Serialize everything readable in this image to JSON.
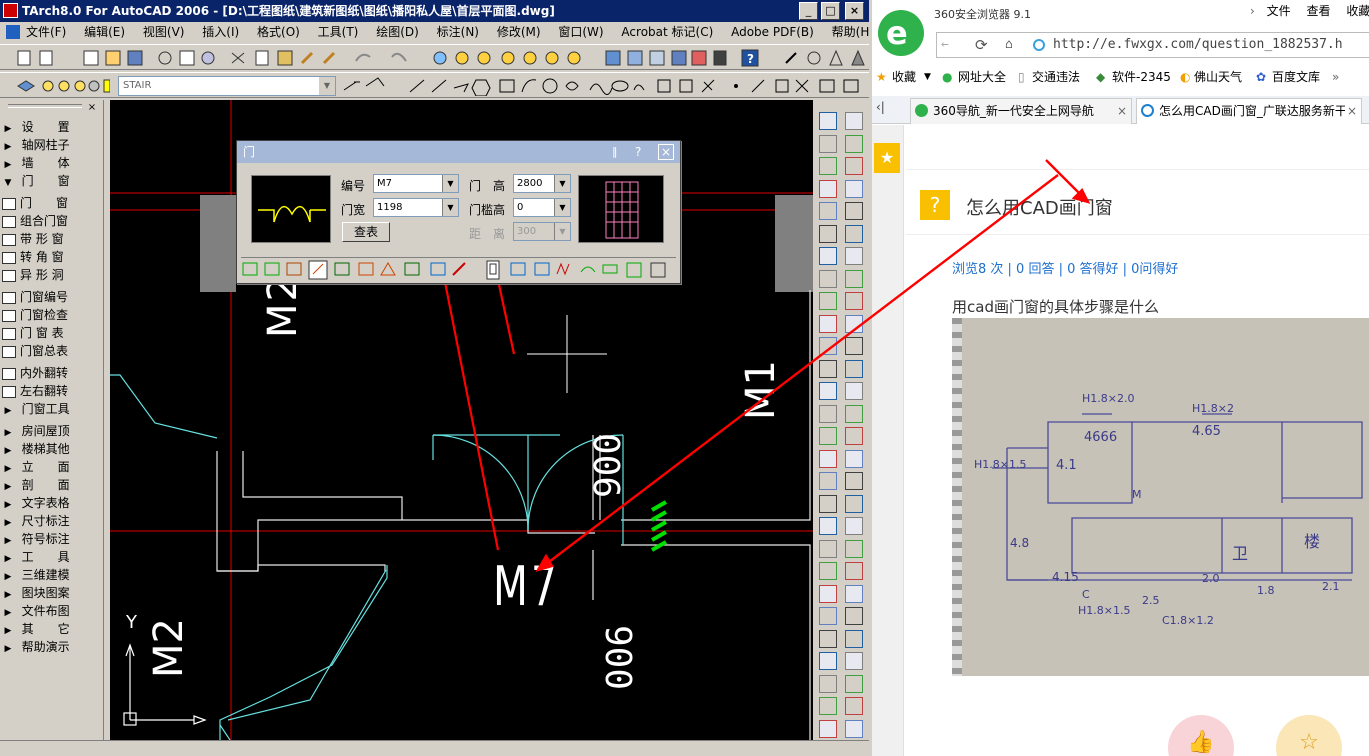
{
  "cad": {
    "title": "TArch8.0 For AutoCAD 2006 - [D:\\工程图纸\\建筑新图纸\\图纸\\播阳私人屋\\首层平面图.dwg]",
    "window_buttons": [
      "_",
      "□",
      "×"
    ],
    "menu": [
      "文件(F)",
      "编辑(E)",
      "视图(V)",
      "插入(I)",
      "格式(O)",
      "工具(T)",
      "绘图(D)",
      "标注(N)",
      "修改(M)",
      "窗口(W)",
      "Acrobat 标记(C)",
      "Adobe PDF(B)",
      "帮助(H)"
    ],
    "layer_combo": "STAIR",
    "sidebar": [
      {
        "label": "设　　置",
        "type": "arrow"
      },
      {
        "label": "轴网柱子",
        "type": "arrow"
      },
      {
        "label": "墙　　体",
        "type": "arrow"
      },
      {
        "label": "门　　窗",
        "type": "open"
      },
      {
        "label": "门　　窗",
        "type": "icon"
      },
      {
        "label": "组合门窗",
        "type": "icon"
      },
      {
        "label": "带 形 窗",
        "type": "icon"
      },
      {
        "label": "转 角 窗",
        "type": "icon"
      },
      {
        "label": "异 形 洞",
        "type": "icon"
      },
      {
        "label": "门窗编号",
        "type": "icon"
      },
      {
        "label": "门窗检查",
        "type": "icon"
      },
      {
        "label": "门 窗 表",
        "type": "icon"
      },
      {
        "label": "门窗总表",
        "type": "icon"
      },
      {
        "label": "内外翻转",
        "type": "icon"
      },
      {
        "label": "左右翻转",
        "type": "icon"
      },
      {
        "label": "门窗工具",
        "type": "arrow"
      },
      {
        "label": "房间屋顶",
        "type": "arrow"
      },
      {
        "label": "楼梯其他",
        "type": "arrow"
      },
      {
        "label": "立　　面",
        "type": "arrow"
      },
      {
        "label": "剖　　面",
        "type": "arrow"
      },
      {
        "label": "文字表格",
        "type": "arrow"
      },
      {
        "label": "尺寸标注",
        "type": "arrow"
      },
      {
        "label": "符号标注",
        "type": "arrow"
      },
      {
        "label": "工　　具",
        "type": "arrow"
      },
      {
        "label": "三维建模",
        "type": "arrow"
      },
      {
        "label": "图块图案",
        "type": "arrow"
      },
      {
        "label": "文件布图",
        "type": "arrow"
      },
      {
        "label": "其　　它",
        "type": "arrow"
      },
      {
        "label": "帮助演示",
        "type": "arrow"
      }
    ],
    "drawing_labels": {
      "m2_top": "M2",
      "m1_right": "M1",
      "m7": "M7",
      "m2_bottom": "M2",
      "dim_top": "900",
      "dim_bottom": "900",
      "axis_y": "Y"
    },
    "dialog": {
      "title": "门",
      "help": "?",
      "close": "×",
      "pin": "📌",
      "number_label": "编号",
      "number_value": "M7",
      "width_label": "门宽",
      "width_value": "1198",
      "height_label": "门　高",
      "height_value": "2800",
      "sill_label": "门槛高",
      "sill_value": "0",
      "distance_label": "距　离",
      "distance_value": "300",
      "table_button": "查表"
    }
  },
  "browser": {
    "app_title": "360安全浏览器 9.1",
    "menu": [
      "文件",
      "查看",
      "收藏"
    ],
    "url": "http://e.fwxgx.com/question_1882537.h",
    "favorites": [
      "收藏",
      "网址大全",
      "交通违法",
      "软件-2345",
      "佛山天气",
      "百度文库"
    ],
    "tabs": [
      {
        "label": "360导航_新一代安全上网导航",
        "active": false
      },
      {
        "label": "怎么用CAD画门窗_广联达服务新干",
        "active": true
      }
    ],
    "question": {
      "title": "怎么用CAD画门窗",
      "stats": "浏览8 次 | 0 回答 | 0 答得好 | 0问得好",
      "body": "用cad画门窗的具体步骤是什么"
    },
    "sketch_labels": [
      "H1.8×2.0",
      "H1.8×2",
      "4666",
      "4.65",
      "H1.8×1.5",
      "4.1",
      "4.8",
      "4.15",
      "2.5",
      "2.0",
      "1.8",
      "2.1",
      "H1.8×1.5",
      "C1.8×1.2",
      "卫",
      "楼",
      "M",
      "C"
    ]
  },
  "colors": {
    "cad_bg": "#000000",
    "cad_red": "#e00000",
    "cad_cyan": "#66e0e0",
    "annot_red": "#ff0000",
    "brand_green": "#2fb24b",
    "link_blue": "#1e6fcf"
  }
}
